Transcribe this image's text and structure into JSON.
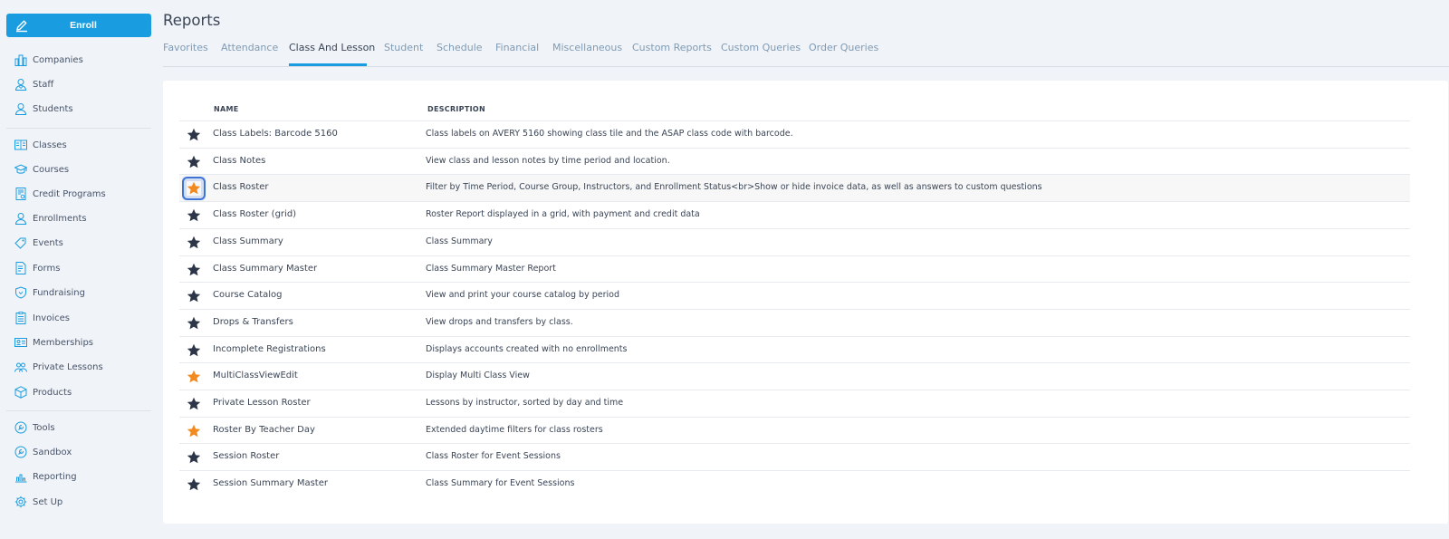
{
  "sidebar": {
    "enroll_label": "Enroll",
    "items": [
      {
        "label": "Companies",
        "icon": "companies-icon"
      },
      {
        "label": "Staff",
        "icon": "staff-icon"
      },
      {
        "label": "Students",
        "icon": "students-icon"
      },
      {
        "label": "Classes",
        "icon": "classes-icon"
      },
      {
        "label": "Courses",
        "icon": "courses-icon"
      },
      {
        "label": "Credit Programs",
        "icon": "credit-programs-icon"
      },
      {
        "label": "Enrollments",
        "icon": "enrollments-icon"
      },
      {
        "label": "Events",
        "icon": "events-icon"
      },
      {
        "label": "Forms",
        "icon": "forms-icon"
      },
      {
        "label": "Fundraising",
        "icon": "fundraising-icon"
      },
      {
        "label": "Invoices",
        "icon": "invoices-icon"
      },
      {
        "label": "Memberships",
        "icon": "memberships-icon"
      },
      {
        "label": "Private Lessons",
        "icon": "private-lessons-icon"
      },
      {
        "label": "Products",
        "icon": "products-icon"
      },
      {
        "label": "Tools",
        "icon": "tools-icon"
      },
      {
        "label": "Sandbox",
        "icon": "sandbox-icon"
      },
      {
        "label": "Reporting",
        "icon": "reporting-icon"
      },
      {
        "label": "Set Up",
        "icon": "setup-icon"
      }
    ]
  },
  "header": {
    "title": "Reports",
    "tabs": [
      "Favorites",
      "Attendance",
      "Class And Lesson",
      "Student",
      "Schedule",
      "Financial",
      "Miscellaneous",
      "Custom Reports",
      "Custom Queries",
      "Order Queries"
    ],
    "active_tab": "Class And Lesson"
  },
  "table": {
    "columns": [
      "NAME",
      "DESCRIPTION"
    ],
    "rows": [
      {
        "name": "Class Labels: Barcode 5160",
        "description": "Class labels on AVERY 5160 showing class tile and the ASAP class code with barcode.",
        "favorite": false
      },
      {
        "name": "Class Notes",
        "description": "View class and lesson notes by time period and location.",
        "favorite": false
      },
      {
        "name": "Class Roster",
        "description": "Filter by Time Period, Course Group, Instructors, and Enrollment Status<br>Show or hide invoice data, as well as answers to custom questions",
        "favorite": true
      },
      {
        "name": "Class Roster (grid)",
        "description": "Roster Report displayed in a grid, with payment and credit data",
        "favorite": false
      },
      {
        "name": "Class Summary",
        "description": "Class Summary",
        "favorite": false
      },
      {
        "name": "Class Summary Master",
        "description": "Class Summary Master Report",
        "favorite": false
      },
      {
        "name": "Course Catalog",
        "description": "View and print your course catalog by period",
        "favorite": false
      },
      {
        "name": "Drops & Transfers",
        "description": "View drops and transfers by class.",
        "favorite": false
      },
      {
        "name": "Incomplete Registrations",
        "description": "Displays accounts created with no enrollments",
        "favorite": false
      },
      {
        "name": "MultiClassViewEdit",
        "description": "Display Multi Class View",
        "favorite": true
      },
      {
        "name": "Private Lesson Roster",
        "description": "Lessons by instructor, sorted by day and time",
        "favorite": false
      },
      {
        "name": "Roster By Teacher Day",
        "description": "Extended daytime filters for class rosters",
        "favorite": true
      },
      {
        "name": "Session Roster",
        "description": "Class Roster for Event Sessions",
        "favorite": false
      },
      {
        "name": "Session Summary Master",
        "description": "Class Summary for Event Sessions",
        "favorite": false
      }
    ]
  },
  "colors": {
    "accent": "#1a9de0",
    "star_default": "#2d3648",
    "star_favorite": "#f28a1f",
    "focus_outline": "#3e74d6"
  }
}
